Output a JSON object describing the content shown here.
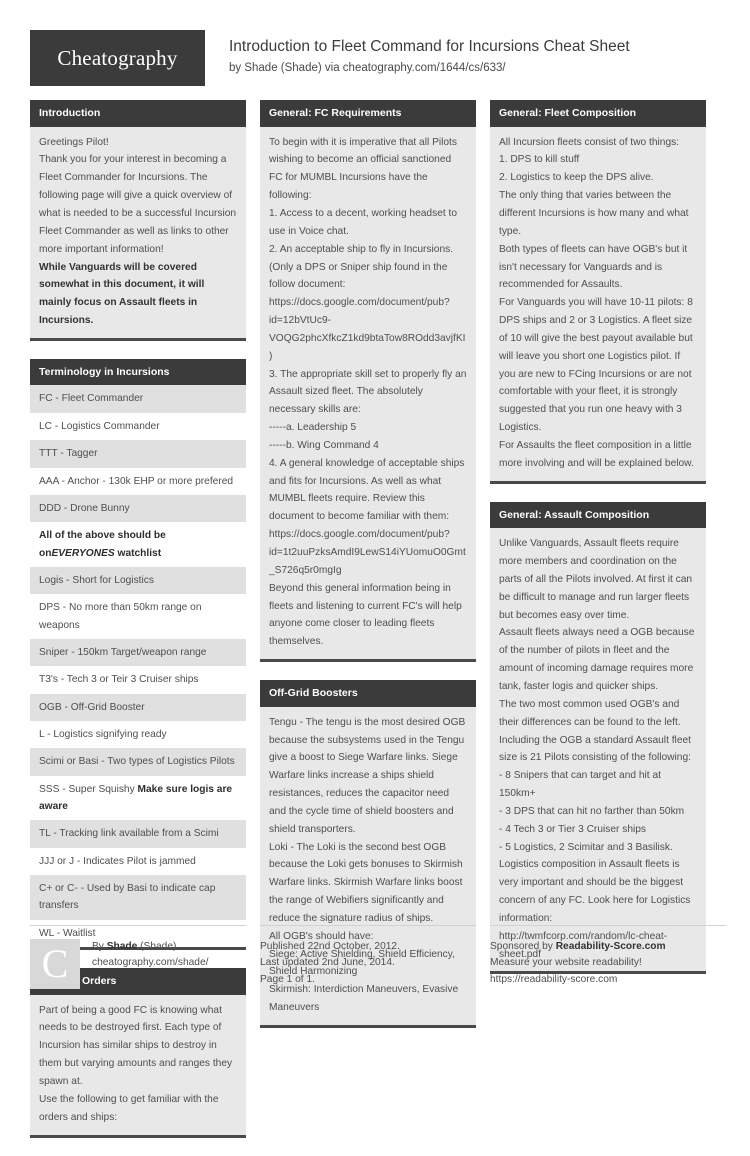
{
  "header": {
    "logo": "Cheatography",
    "title": "Introduction to Fleet Command for Incursions Cheat Sheet",
    "byline": "by Shade (Shade) via cheatography.com/1644/cs/633/"
  },
  "colors": {
    "header_bg": "#3b3b3b",
    "card_bg": "#e8e8e8",
    "stripe": "#e0e0e0",
    "text": "#4f4f4f",
    "rule": "#4a4a4a"
  },
  "cards": {
    "introduction": {
      "title": "Introduction",
      "lines": [
        "Greetings Pilot!",
        "Thank you for your interest in becoming a Fleet Commander for Incursions. The following page will give a quick overview of what is needed to be a successful Incursion Fleet Commander as well as links to other more important information!"
      ],
      "bold_line": "While Vanguards will be covered somewhat in this document, it will mainly focus on Assault fleets in Incursions."
    },
    "terminology": {
      "title": "Terminology in Incursions",
      "rows": [
        {
          "text": "FC - Fleet Commander",
          "bold": false
        },
        {
          "text": "LC - Logistics Commander",
          "bold": false
        },
        {
          "text": "TTT - Tagger",
          "bold": false
        },
        {
          "text": "AAA - Anchor - 130k EHP or more prefered",
          "bold": false
        },
        {
          "text": "DDD - Drone Bunny",
          "bold": false
        },
        {
          "pre": "All of the above should be on",
          "em": "EVERYONES",
          "post": " watchlist",
          "bold": true
        },
        {
          "text": "Logis - Short for Logistics",
          "bold": false
        },
        {
          "text": "DPS - No more than 50km range on weapons",
          "bold": false
        },
        {
          "text": "Sniper - 150km Target/weapon range",
          "bold": false
        },
        {
          "text": "T3's - Tech 3 or Teir 3 Cruiser ships",
          "bold": false
        },
        {
          "text": "OGB - Off-Grid Booster",
          "bold": false
        },
        {
          "text": "L - Logistics signifying ready",
          "bold": false
        },
        {
          "text": "Scimi or Basi - Two types of Logistics Pilots",
          "bold": false
        },
        {
          "pre": "SSS - Super Squishy ",
          "strong": "Make sure logis are aware",
          "bold": false
        },
        {
          "text": "TL - Tracking link available from a Scimi",
          "bold": false
        },
        {
          "text": "JJJ or J - Indicates Pilot is jammed",
          "bold": false
        },
        {
          "text": "C+ or C- - Used by Basi to indicate cap transfers",
          "bold": false
        },
        {
          "text": "WL - Waitlist",
          "bold": false
        }
      ]
    },
    "tagging_orders": {
      "title": "Tagging Orders",
      "lines": [
        "Part of being a good FC is knowing what needs to be destroyed first. Each type of Incursion has similar ships to destroy in them but varying amounts and ranges they spawn at.",
        "Use the following to get familiar with the orders and ships:"
      ]
    },
    "fc_requirements": {
      "title": "General: FC Requirements",
      "lines": [
        "To begin with it is imperative that all Pilots wishing to become an official sanctioned FC for MUMBL Incursions have the following:",
        "1. Access to a decent, working headset to use in Voice chat.",
        "2. An acceptable ship to fly in Incursions. (Only a DPS or Sniper ship found in the follow document:",
        "https://docs.google.com/document/pub?id=12bVtUc9-VOQG2phcXfkcZ1kd9btaTow8ROdd3avjfKI )",
        "3. The appropriate skill set to properly fly an Assault sized fleet. The absolutely necessary skills are:",
        "-----a. Leadership 5",
        "-----b. Wing Command 4",
        "4. A general knowledge of acceptable ships and fits for Incursions. As well as what MUMBL fleets require. Review this document to become familiar with them:",
        "https://docs.google.com/document/pub?id=1t2uuPzksAmdI9LewS14iYUomuO0Gmt_S726q5r0mgIg",
        "Beyond this general information being in fleets and listening to current FC's will help anyone come closer to leading fleets themselves."
      ]
    },
    "off_grid_boosters": {
      "title": "Off-Grid Boosters",
      "lines": [
        "Tengu - The tengu is the most desired OGB because the subsystems used in the Tengu give a boost to Siege Warfare links. Siege Warfare links increase a ships shield resistances, reduces the capacitor need and the cycle time of shield boosters and shield transporters.",
        "Loki - The Loki is the second best OGB because the Loki gets bonuses to Skirmish Warfare links. Skirmish Warfare links boost the range of Webifiers significantly and reduce the signature radius of ships.",
        "All OGB's should have:",
        "Siege: Active Shielding, Shield Efficiency, Shield Harmonizing",
        "Skirmish: Interdiction Maneuvers, Evasive Maneuvers"
      ]
    },
    "fleet_composition": {
      "title": "General: Fleet Composition",
      "lines": [
        "All Incursion fleets consist of two things:",
        "1. DPS to kill stuff",
        "2. Logistics to keep the DPS alive.",
        "The only thing that varies between the different Incursions is how many and what type.",
        "Both types of fleets can have OGB's but it isn't necessary for Vanguards and is recommended for Assaults.",
        "For Vanguards you will have 10-11 pilots: 8 DPS ships and 2 or 3 Logistics. A fleet size of 10 will give the best payout available but will leave you short one Logistics pilot. If you are new to FCing Incursions or are not comfortable with your fleet, it is strongly suggested that you run one heavy with 3 Logistics.",
        "For Assaults the fleet composition in a little more involving and will be explained below."
      ]
    },
    "assault_composition": {
      "title": "General: Assault Composition",
      "lines": [
        "Unlike Vanguards, Assault fleets require more members and coordination on the parts of all the Pilots involved. At first it can be difficult to manage and run larger fleets but becomes easy over time.",
        "Assault fleets always need a OGB because of the number of pilots in fleet and the amount of incoming damage requires more tank, faster logis and quicker ships.",
        "The two most common used OGB's and their differences can be found to the left.",
        "Including the OGB a standard Assault fleet size is 21 Pilots consisting of the following:",
        "- 8 Snipers that can target and hit at 150km+",
        "- 3 DPS that can hit no farther than 50km",
        "- 4 Tech 3 or Tier 3 Cruiser ships",
        "- 5 Logistics, 2 Scimitar and 3 Basilisk.",
        "Logistics composition in Assault fleets is very important and should be the biggest concern of any FC. Look here for Logistics information:",
        "http://twmfcorp.com/random/lc-cheat-sheet.pdf"
      ]
    }
  },
  "footer": {
    "author": {
      "avatar_letter": "C",
      "by_prefix": "By ",
      "name": "Shade",
      "handle": " (Shade)",
      "url": "cheatography.com/shade/"
    },
    "publish": {
      "published": "Published 22nd October, 2012.",
      "updated": "Last updated 2nd June, 2014.",
      "page": "Page 1 of 1."
    },
    "sponsor": {
      "prefix": "Sponsored by ",
      "name": "Readability-Score.com",
      "tagline": "Measure your website readability!",
      "url": "https://readability-score.com"
    }
  }
}
